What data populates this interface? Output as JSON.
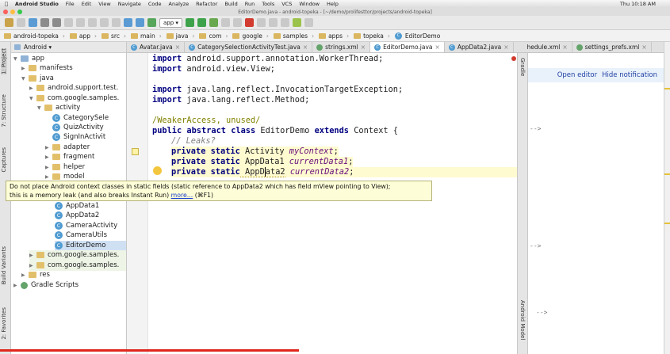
{
  "menubar": {
    "app": "Android Studio",
    "items": [
      "File",
      "Edit",
      "View",
      "Navigate",
      "Code",
      "Analyze",
      "Refactor",
      "Build",
      "Run",
      "Tools",
      "VCS",
      "Window",
      "Help"
    ],
    "clock": "Thu 10:18 AM"
  },
  "window": {
    "title": "EditorDemo.java - android-topeka - [~/demo/prolifesttor/projects/android-topeka]"
  },
  "toolbar": {
    "run_config": "app"
  },
  "breadcrumbs": [
    "android-topeka",
    "app",
    "src",
    "main",
    "java",
    "com",
    "google",
    "samples",
    "apps",
    "topeka",
    "EditorDemo"
  ],
  "left_strip": {
    "project": "1: Project",
    "structure": "7: Structure",
    "captures": "Captures",
    "build_variants": "Build Variants",
    "favorites": "2: Favorites"
  },
  "project_panel": {
    "view_mode": "Android",
    "tree": [
      {
        "label": "app",
        "kind": "folder-blue",
        "expanded": true
      },
      {
        "label": "manifests",
        "kind": "folder",
        "expanded": false
      },
      {
        "label": "java",
        "kind": "folder",
        "expanded": true
      },
      {
        "label": "android.support.test.",
        "kind": "folder",
        "expanded": false
      },
      {
        "label": "com.google.samples.",
        "kind": "folder",
        "expanded": true
      },
      {
        "label": "activity",
        "kind": "folder",
        "expanded": true
      },
      {
        "label": "CategorySele",
        "kind": "class"
      },
      {
        "label": "QuizActivity",
        "kind": "class"
      },
      {
        "label": "SignInActivit",
        "kind": "class"
      },
      {
        "label": "adapter",
        "kind": "folder",
        "expanded": false
      },
      {
        "label": "fragment",
        "kind": "folder",
        "expanded": false
      },
      {
        "label": "helper",
        "kind": "folder",
        "expanded": false
      },
      {
        "label": "model",
        "kind": "folder",
        "expanded": false
      },
      {
        "label": "AppData1",
        "kind": "class"
      },
      {
        "label": "AppData2",
        "kind": "class"
      },
      {
        "label": "CameraActivity",
        "kind": "class"
      },
      {
        "label": "CameraUtils",
        "kind": "class"
      },
      {
        "label": "EditorDemo",
        "kind": "class",
        "selected": true
      },
      {
        "label": "com.google.samples.",
        "kind": "folder",
        "expanded": false
      },
      {
        "label": "com.google.samples.",
        "kind": "folder",
        "expanded": false
      },
      {
        "label": "res",
        "kind": "folder",
        "expanded": false
      },
      {
        "label": "Gradle Scripts",
        "kind": "gradle",
        "expanded": false
      }
    ]
  },
  "tabs": [
    {
      "label": "Avatar.java",
      "active": false
    },
    {
      "label": "CategorySelectionActivityTest.java",
      "active": false
    },
    {
      "label": "strings.xml",
      "active": false
    },
    {
      "label": "EditorDemo.java",
      "active": true
    },
    {
      "label": "AppData2.java",
      "active": false
    },
    {
      "label": "hedule.xml",
      "active": false
    },
    {
      "label": "settings_prefs.xml",
      "active": false
    }
  ],
  "code": {
    "l1_kw": "import",
    "l1_rest": " android.support.annotation.WorkerThread;",
    "l2_kw": "import",
    "l2_rest": " android.view.View;",
    "l3_kw": "import",
    "l3_rest": " java.lang.reflect.InvocationTargetException;",
    "l4_kw": "import",
    "l4_rest": " java.lang.reflect.Method;",
    "l5_comment": "/WeakerAccess, unused/",
    "l6_kw": "public abstract class",
    "l6_mid": " EditorDemo ",
    "l6_kw2": "extends",
    "l6_rest": " Context {",
    "l7_comment": "// Leaks?",
    "l8_kw": "private static",
    "l8_type": " Activity ",
    "l8_field": "myContext",
    "l8_end": ";",
    "l9_kw": "private static",
    "l9_type": " AppData1 ",
    "l9_field": "currentData1",
    "l9_end": ";",
    "l10_kw": "private static",
    "l10_type_a": " AppD",
    "l10_type_b": "ata2",
    "l10_sp": " ",
    "l10_field": "currentData2",
    "l10_end": ";"
  },
  "tooltip": {
    "line1": "Do not place Android context classes in static fields (static reference to AppData2 which has field mView pointing to View);",
    "line2": "this is a memory leak (and also breaks Instant Run) ",
    "more": "more...",
    "shortcut": " (⌘F1)"
  },
  "gradle_strip": {
    "gradle": "Gradle",
    "android_model": "Android Model"
  },
  "notification": {
    "open_editor": "Open editor",
    "hide": "Hide notification"
  },
  "arrows": [
    "-->",
    "-->",
    "-->"
  ],
  "colors": {
    "progress": "#e0261e",
    "tooltip_bg": "#fdfdd7",
    "keyword": "#000080",
    "field": "#660e7a"
  }
}
